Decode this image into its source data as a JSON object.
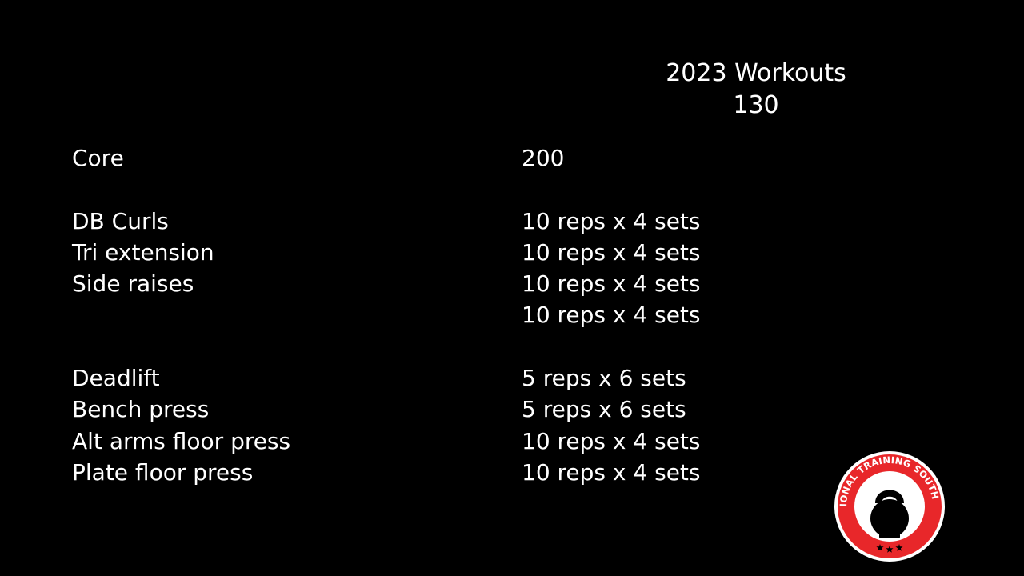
{
  "header": {
    "title": "2023 Workouts",
    "number": "130"
  },
  "core": {
    "label": "Core",
    "value": "200"
  },
  "group1": [
    {
      "name": "DB Curls",
      "value": "10 reps x 4 sets"
    },
    {
      "name": "Tri extension",
      "value": "10 reps x 4 sets"
    },
    {
      "name": "Side raises",
      "value": "10 reps x 4 sets"
    },
    {
      "name": "",
      "value": "10 reps x 4 sets"
    }
  ],
  "group2": [
    {
      "name": "Deadlift",
      "value": "5 reps x 6 sets"
    },
    {
      "name": "Bench press",
      "value": "5 reps x 6 sets"
    },
    {
      "name": "Alt arms floor press",
      "value": "10 reps x 4 sets"
    },
    {
      "name": "Plate floor press",
      "value": "10 reps x 4 sets"
    }
  ],
  "logo": {
    "text": "FUNCTIONAL TRAINING SOUTH AFRICA",
    "icon": "kettlebell-icon",
    "colors": {
      "ring": "#e8272a",
      "inner": "#ffffff",
      "bell": "#000000"
    }
  }
}
